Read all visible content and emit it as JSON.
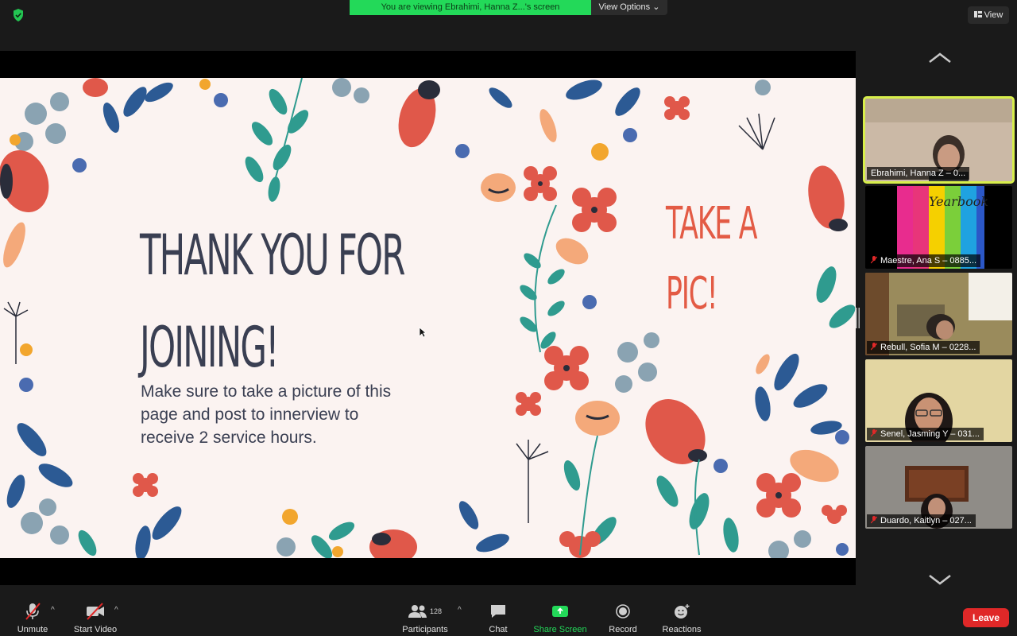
{
  "banner": {
    "text": "You are viewing Ebrahimi, Hanna Z...'s screen",
    "view_options": "View Options ⌄"
  },
  "topbar": {
    "view_label": "View"
  },
  "slide": {
    "title_line1": "THANK YOU FOR",
    "title_line2": "JOINING!",
    "body": "Make sure to take a picture of this page and post to innerview to receive 2 service hours.",
    "take_line1": "TAKE A",
    "take_line2": "PIC!"
  },
  "gallery": {
    "tiles": [
      {
        "name": "Ebrahimi, Hanna Z – 0..."
      },
      {
        "name": "Maestre, Ana S – 0885...",
        "yearbook_text": "Yearbook"
      },
      {
        "name": "Rebull, Sofia M – 0228..."
      },
      {
        "name": "Senel, Jasming Y – 031..."
      },
      {
        "name": "Duardo, Kaitlyn – 027..."
      }
    ]
  },
  "toolbar": {
    "unmute": "Unmute",
    "start_video": "Start Video",
    "participants": "Participants",
    "participants_count": "128",
    "chat": "Chat",
    "share_screen": "Share Screen",
    "record": "Record",
    "reactions": "Reactions",
    "leave": "Leave"
  },
  "colors": {
    "banner_green": "#23d959",
    "active_speaker": "#d8ef4b",
    "leave_red": "#e02828",
    "slide_title": "#3a3f52",
    "slide_accent": "#e35b45"
  },
  "icons": [
    "shield-icon",
    "view-icon",
    "chevron-up-icon",
    "chevron-down-icon",
    "mic-off-icon",
    "video-off-icon",
    "participants-icon",
    "chat-icon",
    "share-screen-icon",
    "record-icon",
    "reactions-icon"
  ]
}
